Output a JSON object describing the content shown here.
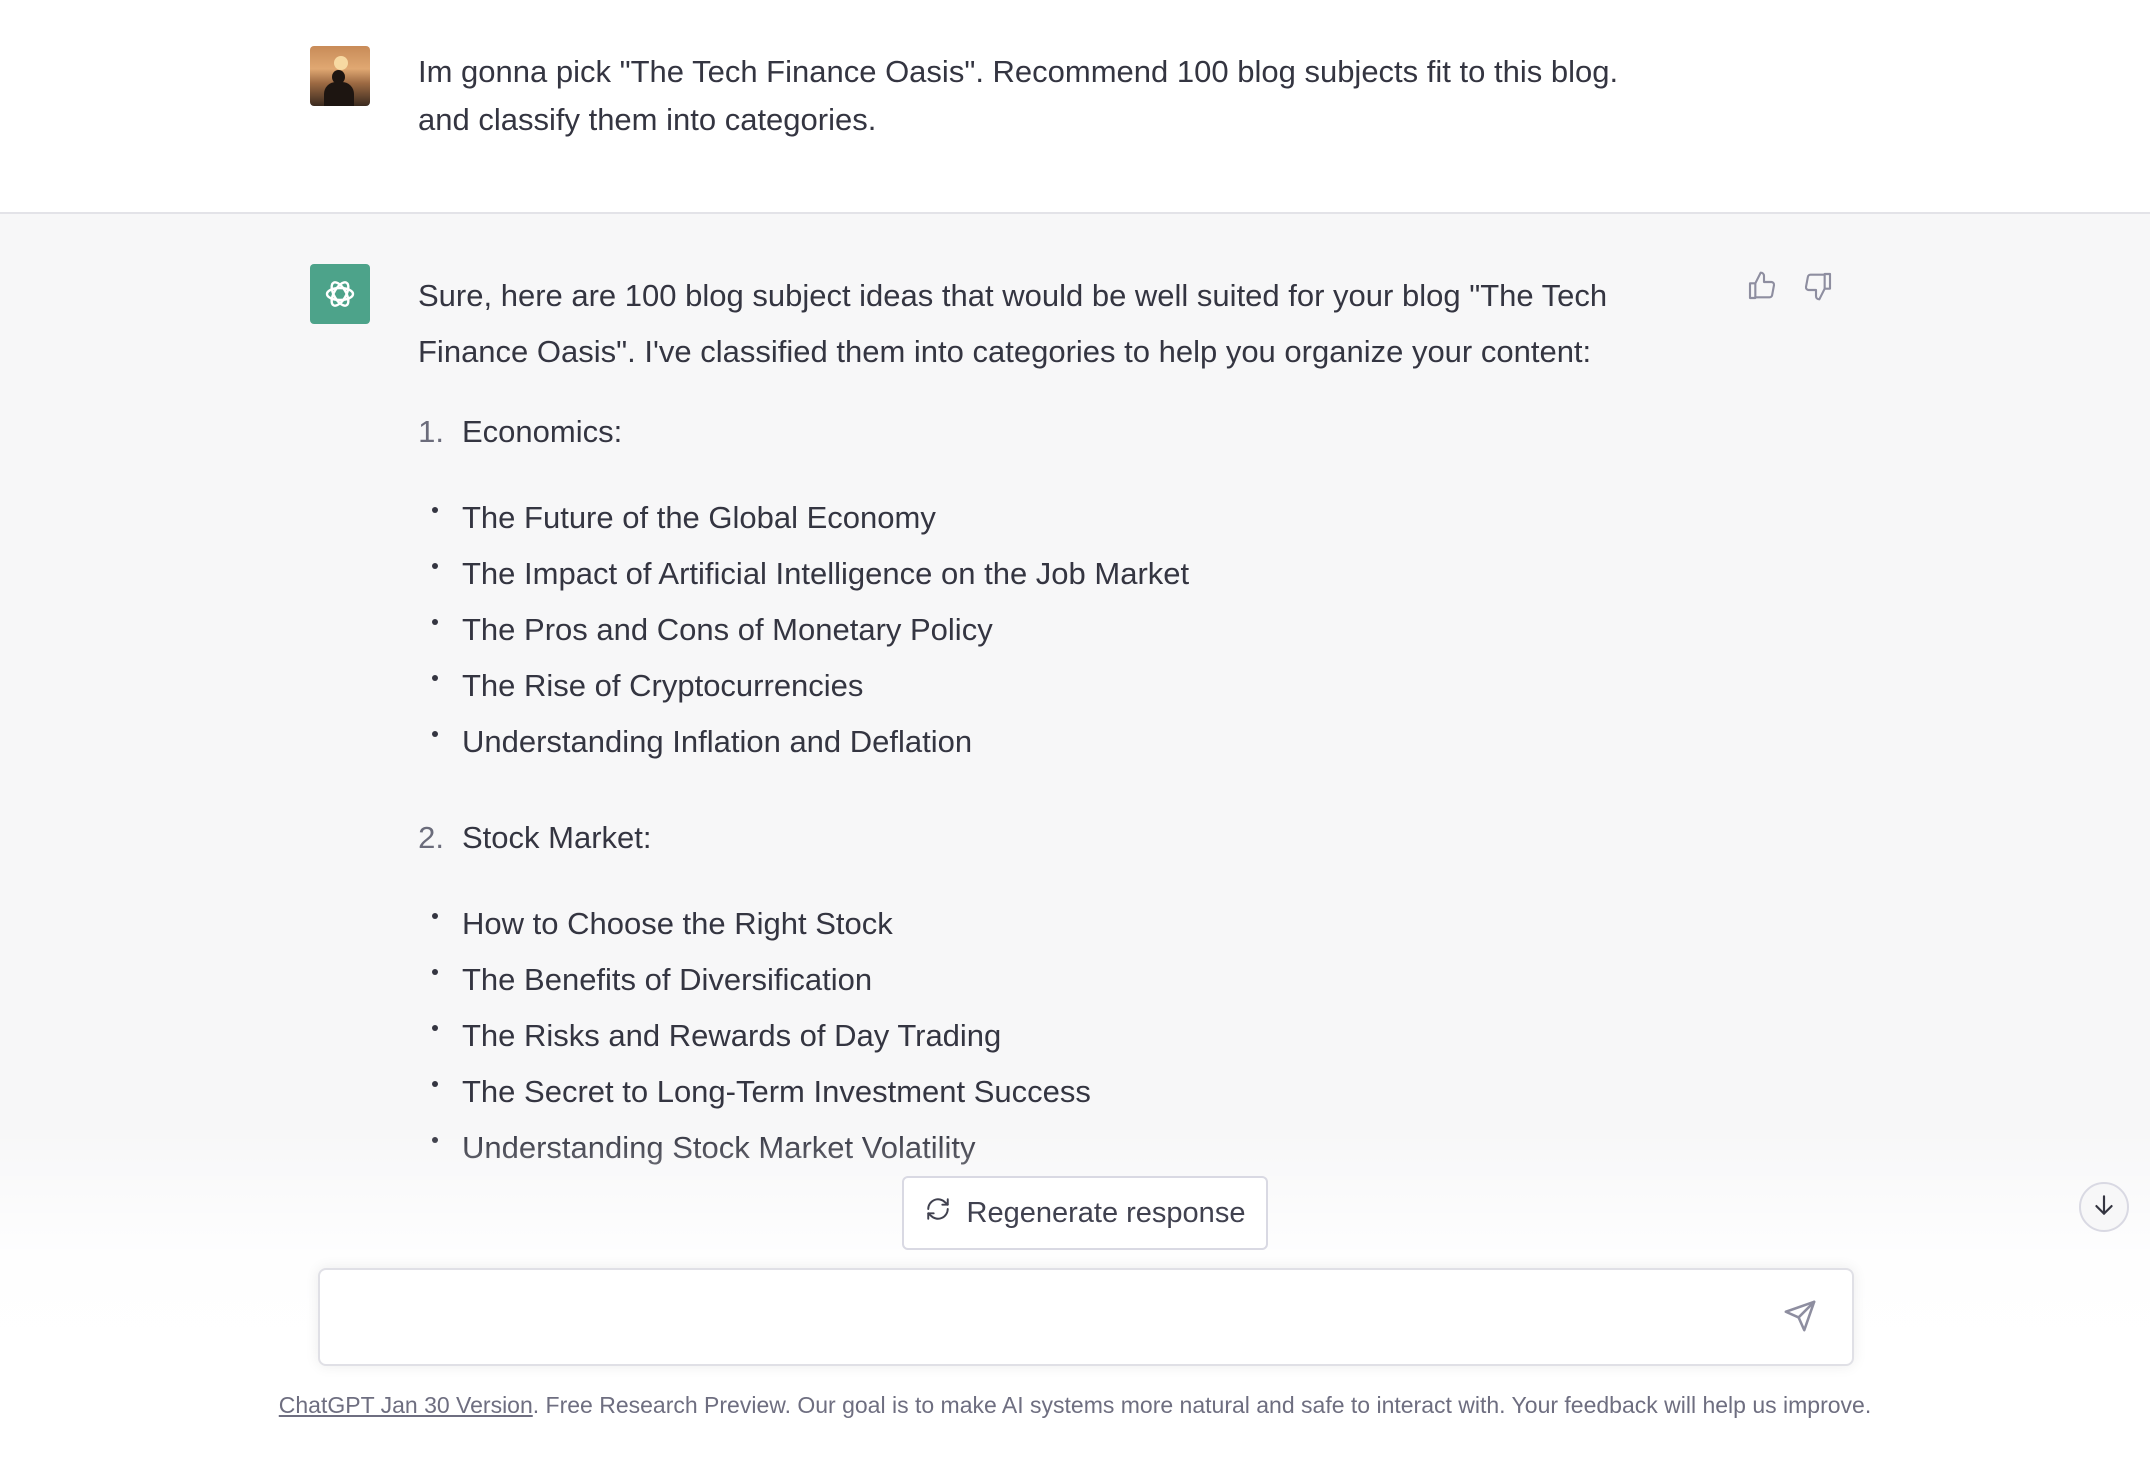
{
  "user_message": {
    "avatar": "user-profile-photo",
    "line1": "Im gonna pick \"The Tech Finance Oasis\". Recommend 100 blog subjects fit to this blog.",
    "line2": "and classify them into categories."
  },
  "assistant_message": {
    "avatar": "openai-logo-icon",
    "intro_line1": "Sure, here are 100 blog subject ideas that would be well suited for your blog \"The Tech",
    "intro_line2": "Finance Oasis\". I've classified them into categories to help you organize your content:",
    "categories": [
      {
        "number": "1.",
        "title": "Economics:",
        "topics": [
          "The Future of the Global Economy",
          "The Impact of Artificial Intelligence on the Job Market",
          "The Pros and Cons of Monetary Policy",
          "The Rise of Cryptocurrencies",
          "Understanding Inflation and Deflation"
        ]
      },
      {
        "number": "2.",
        "title": "Stock Market:",
        "topics": [
          "How to Choose the Right Stock",
          "The Benefits of Diversification",
          "The Risks and Rewards of Day Trading",
          "The Secret to Long-Term Investment Success",
          "Understanding Stock Market Volatility"
        ]
      }
    ],
    "feedback": {
      "like_icon": "thumbs-up-icon",
      "dislike_icon": "thumbs-down-icon"
    }
  },
  "regenerate_button": {
    "label": "Regenerate response",
    "icon": "refresh-icon"
  },
  "scroll_button": {
    "icon": "arrow-down-icon"
  },
  "composer": {
    "placeholder": "",
    "send_icon": "paper-plane-icon"
  },
  "footer": {
    "link_text": "ChatGPT Jan 30 Version",
    "text": ". Free Research Preview. Our goal is to make AI systems more natural and safe to interact with. Your feedback will help us improve."
  }
}
